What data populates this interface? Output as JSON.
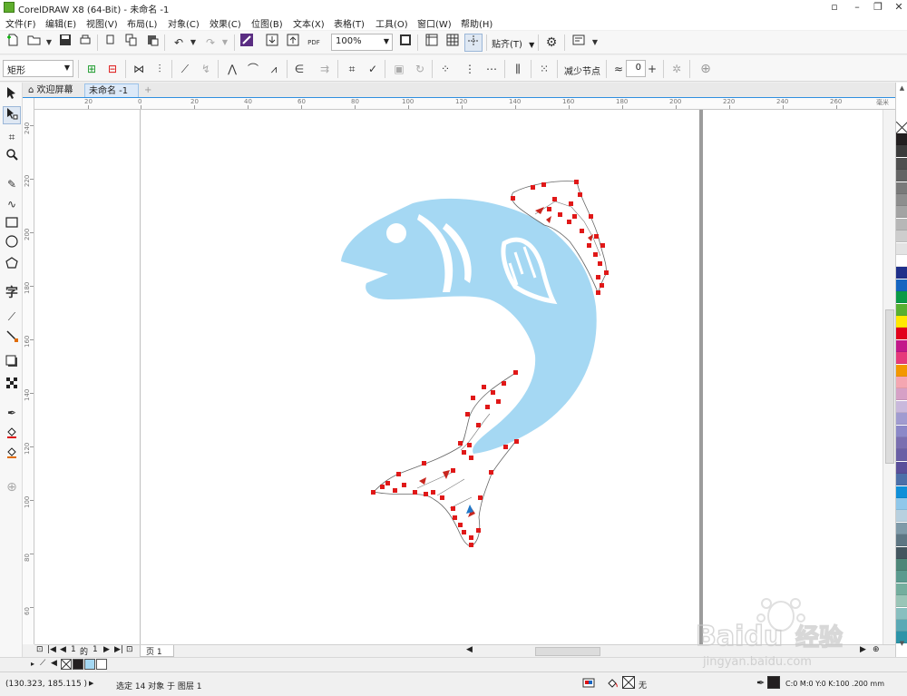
{
  "window": {
    "title": "CorelDRAW X8 (64-Bit) - 未命名 -1",
    "controls": [
      "▫",
      "–",
      "❐",
      "✕"
    ]
  },
  "menu": [
    "文件(F)",
    "编辑(E)",
    "视图(V)",
    "布局(L)",
    "对象(C)",
    "效果(C)",
    "位图(B)",
    "文本(X)",
    "表格(T)",
    "工具(O)",
    "窗口(W)",
    "帮助(H)"
  ],
  "toolbar": {
    "zoom": "100%",
    "snap_label": "贴齐(T)"
  },
  "property_bar": {
    "shape_type": "矩形",
    "reduce_nodes_label": "减少节点",
    "curve_smoothness": "0"
  },
  "tabs": {
    "welcome": "欢迎屏幕",
    "document": "未命名 -1"
  },
  "ruler": {
    "h_labels": [
      "20",
      "0",
      "20",
      "40",
      "60",
      "80",
      "100",
      "120",
      "140",
      "160",
      "180",
      "200",
      "220",
      "240",
      "260",
      "毫米"
    ],
    "v_labels": [
      "240",
      "220",
      "200",
      "180",
      "160",
      "140",
      "120",
      "100",
      "80",
      "60"
    ]
  },
  "page_nav": {
    "current": "1",
    "of_label": "的",
    "total": "1",
    "page_tab": "页 1"
  },
  "status": {
    "cursor_coords": "(130.323, 185.115 )",
    "selection_info": "选定 14 对象 于 图层 1",
    "fill_none": "无",
    "outline_info": "C:0 M:0 Y:0 K:100  .200 mm"
  },
  "watermark": {
    "brand": "Baidu",
    "cn": "经验",
    "url": "jingyan.baidu.com"
  },
  "colors": {
    "fish_fill": "#a5d8f3",
    "node_color": "#e01818",
    "palette": [
      "#231f20",
      "#3b3b3b",
      "#4f4f4f",
      "#646464",
      "#7a7a7a",
      "#8e8e8e",
      "#a3a3a3",
      "#b7b7b7",
      "#cdcdcd",
      "#e3e3e3",
      "#ffffff",
      "#1f2f8a",
      "#1565c0",
      "#0a9a46",
      "#58b031",
      "#ffe800",
      "#e2001a",
      "#c2188a",
      "#e6397a",
      "#f39800",
      "#f5a6b1",
      "#d6a0c6",
      "#c9b8dc",
      "#a09bd0",
      "#8b88c8",
      "#7a6fb0",
      "#6a5fa5",
      "#5a4f9a",
      "#4c6fa8",
      "#0f8fd8",
      "#8fc7ea",
      "#b8d0df",
      "#7f9aa8",
      "#5e7683",
      "#44565f",
      "#4e8678",
      "#5a9a8e",
      "#74ae9e",
      "#9ac5b7",
      "#88bfbf",
      "#5aa9b5",
      "#2c94a8"
    ]
  }
}
